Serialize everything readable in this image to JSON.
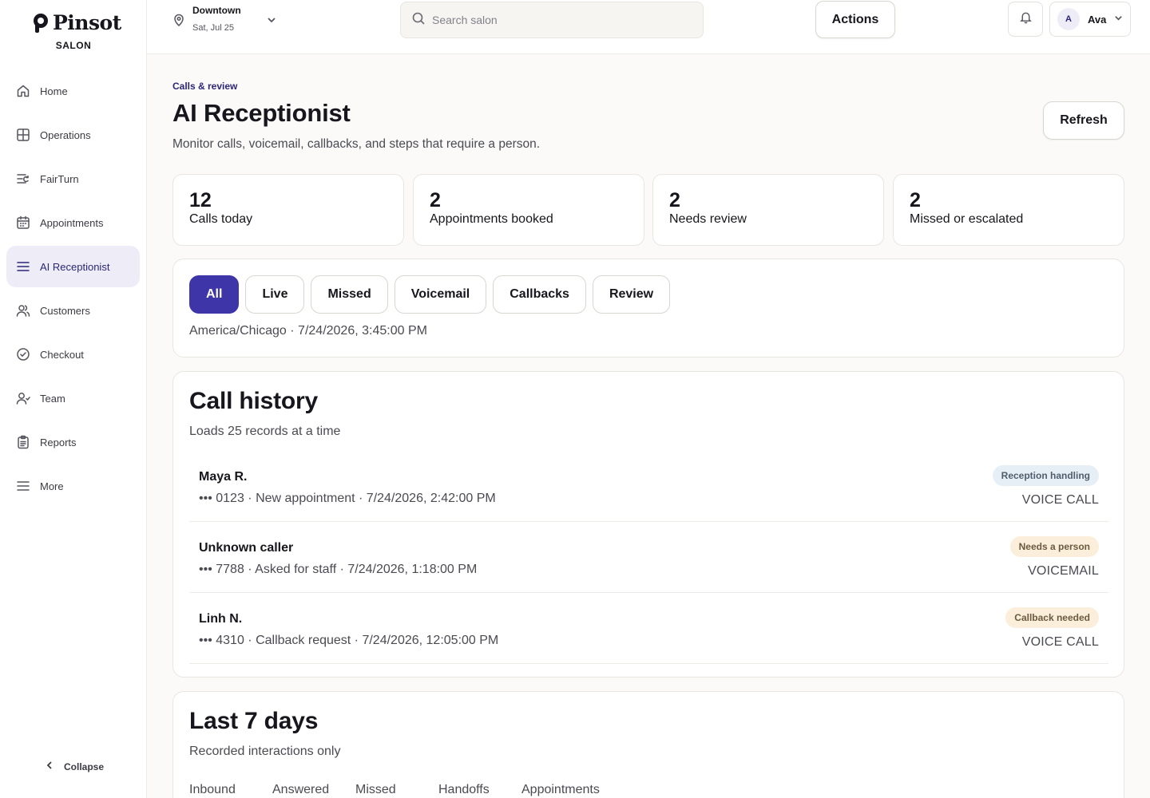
{
  "brand": {
    "name": "Pinsot",
    "sub": "SALON"
  },
  "sidebar": {
    "items": [
      {
        "label": "Home",
        "icon": "home-icon"
      },
      {
        "label": "Operations",
        "icon": "grid-icon"
      },
      {
        "label": "FairTurn",
        "icon": "rotation-icon"
      },
      {
        "label": "Appointments",
        "icon": "calendar-icon"
      },
      {
        "label": "AI Receptionist",
        "icon": "menu-lines-icon",
        "active": true
      },
      {
        "label": "Customers",
        "icon": "users-icon"
      },
      {
        "label": "Checkout",
        "icon": "check-circle-icon"
      },
      {
        "label": "Team",
        "icon": "team-icon"
      },
      {
        "label": "Reports",
        "icon": "clipboard-icon"
      },
      {
        "label": "More",
        "icon": "menu-icon"
      }
    ],
    "collapse_label": "Collapse"
  },
  "header": {
    "location_name": "Downtown",
    "location_date": "Sat, Jul 25",
    "search_placeholder": "Search salon",
    "actions_label": "Actions",
    "user_initial": "A",
    "user_name": "Ava"
  },
  "page": {
    "eyebrow": "Calls & review",
    "title": "AI Receptionist",
    "description": "Monitor calls, voicemail, callbacks, and steps that require a person.",
    "refresh_label": "Refresh"
  },
  "stats": [
    {
      "value": "12",
      "label": "Calls today"
    },
    {
      "value": "2",
      "label": "Appointments booked"
    },
    {
      "value": "2",
      "label": "Needs review"
    },
    {
      "value": "2",
      "label": "Missed or escalated"
    }
  ],
  "filters": {
    "chips": [
      "All",
      "Live",
      "Missed",
      "Voicemail",
      "Callbacks",
      "Review"
    ],
    "active": "All",
    "timezone_line": "America/Chicago · 7/24/2026, 3:45:00 PM"
  },
  "call_history": {
    "title": "Call history",
    "subtitle": "Loads 25 records at a time",
    "rows": [
      {
        "name": "Maya R.",
        "meta": "••• 0123 · New appointment · 7/24/2026, 2:42:00 PM",
        "badge": "Reception handling",
        "badge_tone": "blue",
        "type": "VOICE CALL"
      },
      {
        "name": "Unknown caller",
        "meta": "••• 7788 · Asked for staff · 7/24/2026, 1:18:00 PM",
        "badge": "Needs a person",
        "badge_tone": "amber",
        "type": "VOICEMAIL"
      },
      {
        "name": "Linh N.",
        "meta": "••• 4310 · Callback request · 7/24/2026, 12:05:00 PM",
        "badge": "Callback needed",
        "badge_tone": "amber",
        "type": "VOICE CALL"
      }
    ]
  },
  "last_7_days": {
    "title": "Last 7 days",
    "subtitle": "Recorded interactions only",
    "metrics": [
      "Inbound",
      "Answered",
      "Missed",
      "Handoffs",
      "Appointments"
    ]
  },
  "colors": {
    "accent": "#3d35a8",
    "accent_text": "#2b2678",
    "active_nav_bg": "#eeedf7",
    "badge_blue_bg": "#e7eff6",
    "badge_amber_bg": "#fbeedb"
  }
}
